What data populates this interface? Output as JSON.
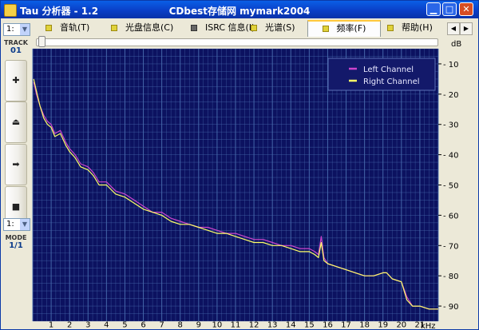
{
  "window": {
    "title": "Tau 分析器 - 1.2",
    "center_title": "CDbest存储网 mymark2004",
    "min_glyph": "▁",
    "max_glyph": "□",
    "close_glyph": "✕"
  },
  "sidebar": {
    "track_select": "1:",
    "track_label": "TRACK",
    "track_value": "01",
    "buttons": [
      {
        "glyph": "✚"
      },
      {
        "glyph": "⏏"
      },
      {
        "glyph": "➡"
      },
      {
        "glyph": "■"
      }
    ],
    "mode_select": "1:",
    "mode_label": "MODE",
    "mode_value": "1/1"
  },
  "tabs": [
    {
      "label": "音轨(T)",
      "active": false
    },
    {
      "label": "光盘信息(C)",
      "active": false
    },
    {
      "label": "ISRC 信息(I)",
      "active": false
    },
    {
      "label": "光谱(S)",
      "active": false
    },
    {
      "label": "频率(F)",
      "active": true
    },
    {
      "label": "帮助(H)",
      "active": false
    }
  ],
  "tab_nav": {
    "prev": "◀",
    "next": "▶"
  },
  "colors": {
    "plot_bg": "#0c1260",
    "grid": "#4a6eb0",
    "left_channel": "#cc44cc",
    "right_channel": "#ffff66",
    "legend_bg": "#13196a"
  },
  "chart_data": {
    "type": "line",
    "xlabel": "kHz",
    "ylabel": "dB",
    "xlim": [
      0,
      22
    ],
    "ylim": [
      -95,
      -5
    ],
    "x_ticks": [
      1,
      2,
      3,
      4,
      5,
      6,
      7,
      8,
      9,
      10,
      11,
      12,
      13,
      14,
      15,
      16,
      17,
      18,
      19,
      20,
      21
    ],
    "y_ticks": [
      -10,
      -20,
      -30,
      -40,
      -50,
      -60,
      -70,
      -80,
      -90
    ],
    "grid": true,
    "legend_position": "top-right",
    "series": [
      {
        "name": "Left Channel",
        "x": [
          0.05,
          0.2,
          0.4,
          0.6,
          0.8,
          1,
          1.2,
          1.5,
          1.8,
          2,
          2.3,
          2.6,
          3,
          3.3,
          3.6,
          4,
          4.5,
          5,
          5.5,
          6,
          6.5,
          7,
          7.5,
          8,
          8.5,
          9,
          9.5,
          10,
          10.5,
          11,
          11.5,
          12,
          12.5,
          13,
          13.5,
          14,
          14.5,
          15,
          15.3,
          15.5,
          15.65,
          15.8,
          16,
          16.5,
          17,
          17.5,
          18,
          18.5,
          19,
          19.2,
          19.5,
          20,
          20.3,
          20.6,
          21,
          21.5,
          22
        ],
        "y": [
          -16,
          -20,
          -24,
          -27,
          -29,
          -30,
          -33,
          -32,
          -36,
          -38,
          -40,
          -43,
          -44,
          -46,
          -49,
          -49,
          -52,
          -53,
          -55,
          -57,
          -59,
          -59,
          -61,
          -62,
          -63,
          -64,
          -64,
          -65,
          -66,
          -66,
          -67,
          -68,
          -68,
          -69,
          -70,
          -70,
          -71,
          -71,
          -72,
          -73,
          -67,
          -74,
          -76,
          -77,
          -78,
          -79,
          -80,
          -80,
          -79,
          -79,
          -81,
          -82,
          -87,
          -90,
          -90,
          -91,
          -91
        ]
      },
      {
        "name": "Right Channel",
        "x": [
          0.05,
          0.2,
          0.4,
          0.6,
          0.8,
          1,
          1.2,
          1.5,
          1.8,
          2,
          2.3,
          2.6,
          3,
          3.3,
          3.6,
          4,
          4.5,
          5,
          5.5,
          6,
          6.5,
          7,
          7.5,
          8,
          8.5,
          9,
          9.5,
          10,
          10.5,
          11,
          11.5,
          12,
          12.5,
          13,
          13.5,
          14,
          14.5,
          15,
          15.3,
          15.5,
          15.65,
          15.8,
          16,
          16.5,
          17,
          17.5,
          18,
          18.5,
          19,
          19.2,
          19.5,
          20,
          20.3,
          20.6,
          21,
          21.5,
          22
        ],
        "y": [
          -15,
          -19,
          -24,
          -28,
          -30,
          -31,
          -34,
          -33,
          -37,
          -39,
          -41,
          -44,
          -45,
          -47,
          -50,
          -50,
          -53,
          -54,
          -56,
          -58,
          -59,
          -60,
          -62,
          -63,
          -63,
          -64,
          -65,
          -66,
          -66,
          -67,
          -68,
          -69,
          -69,
          -70,
          -70,
          -71,
          -72,
          -72,
          -73,
          -74,
          -69,
          -75,
          -76,
          -77,
          -78,
          -79,
          -80,
          -80,
          -79,
          -79,
          -81,
          -82,
          -88,
          -90,
          -90,
          -91,
          -91
        ]
      }
    ]
  }
}
